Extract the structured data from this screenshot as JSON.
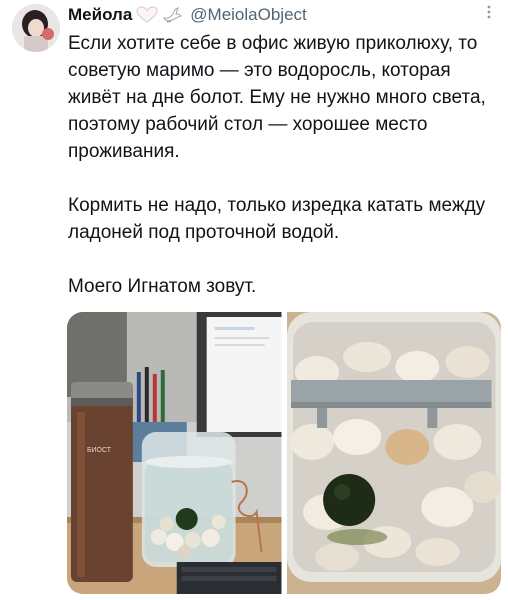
{
  "author": {
    "name": "Мейола",
    "handle": "@MeiolaObject",
    "emoji_1": "white-heart-icon",
    "emoji_2": "dove-icon"
  },
  "tweet": {
    "paragraphs": [
      "Если хотите себе в офис живую приколюху, то советую маримо — это водоросль, которая живёт на дне болот. Ему не нужно много света, поэтому рабочий стол — хорошее место проживания.",
      "Кормить не надо, только изредка катать между ладоней под проточной водой.",
      "Моего Игнатом зовут."
    ]
  },
  "media": {
    "photo_1": "office-desk-jar-photo",
    "photo_2": "marimo-closeup-photo",
    "bottle_label": "БИОСТ"
  },
  "colors": {
    "text": "#0f1419",
    "secondary": "#536471"
  }
}
